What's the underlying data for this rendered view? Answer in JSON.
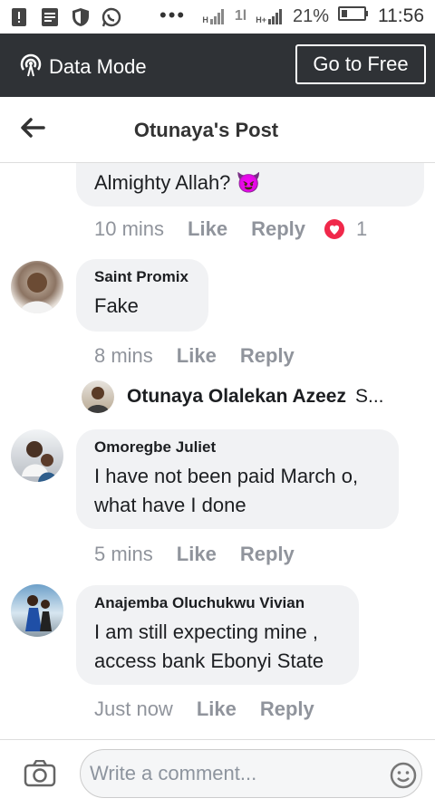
{
  "status_bar": {
    "dots": "•••",
    "signal1": "H",
    "signal2": "1l",
    "signal3": "H+",
    "battery_percent": "21%",
    "time": "11:56"
  },
  "data_mode": {
    "label": "Data Mode",
    "button": "Go to Free"
  },
  "header": {
    "title": "Otunaya's Post"
  },
  "comments": [
    {
      "text": "Almighty Allah? 😈",
      "time": "10 mins",
      "like": "Like",
      "reply": "Reply",
      "reaction_count": "1"
    },
    {
      "name": "Saint Promix",
      "text": "Fake",
      "time": "8 mins",
      "like": "Like",
      "reply": "Reply"
    },
    {
      "name": "Omoregbe Juliet",
      "text_line1": "I have not been paid March o,",
      "text_line2": "what have I done",
      "time": "5 mins",
      "like": "Like",
      "reply": "Reply"
    },
    {
      "name": "Anajemba Oluchukwu Vivian",
      "text_line1": "I am still expecting mine ,",
      "text_line2": "access bank Ebonyi State",
      "time": "Just now",
      "like": "Like",
      "reply": "Reply"
    }
  ],
  "reply_preview": {
    "name": "Otunaya Olalekan Azeez",
    "snippet": "S..."
  },
  "composer": {
    "placeholder": "Write a comment..."
  },
  "colors": {
    "data_mode_bg": "#2f3236",
    "bubble_bg": "#f1f2f4",
    "meta_text": "#90949c",
    "reaction_red": "#f0284a"
  }
}
